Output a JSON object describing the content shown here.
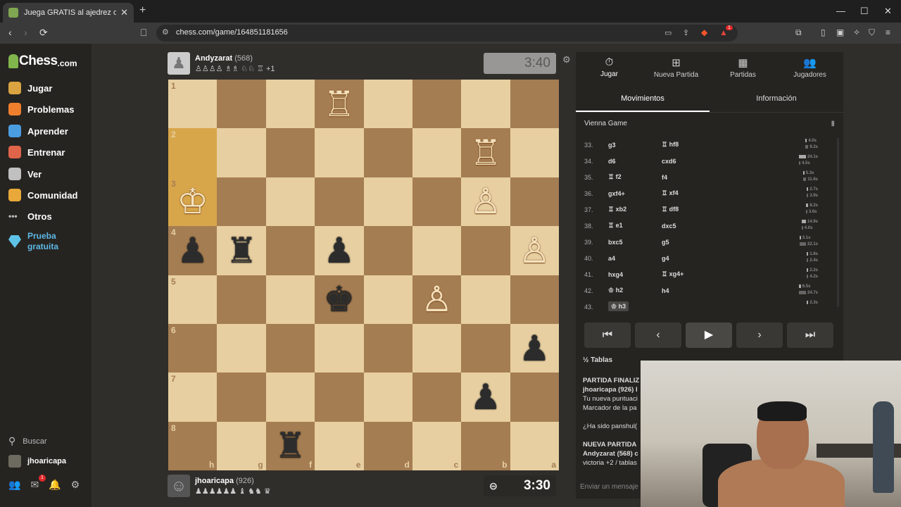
{
  "browser": {
    "tab_title": "Juega GRATIS al ajedrez online -",
    "url": "chess.com/game/164851181656",
    "ext_badge": "1"
  },
  "sidebar": {
    "logo_main": "Chess",
    "logo_com": ".com",
    "items": [
      {
        "label": "Jugar",
        "color": "#d9a441"
      },
      {
        "label": "Problemas",
        "color": "#f07f2d"
      },
      {
        "label": "Aprender",
        "color": "#4a9ee0"
      },
      {
        "label": "Entrenar",
        "color": "#e0644a"
      },
      {
        "label": "Ver",
        "color": "#c0c0c0"
      },
      {
        "label": "Comunidad",
        "color": "#e8a93a"
      },
      {
        "label": "Otros",
        "color": "#bdbdbd"
      }
    ],
    "trial": "Prueba gratuita",
    "search": "Buscar",
    "user": "jhoaricapa",
    "mail_badge": "1"
  },
  "top_player": {
    "name": "Andyzarat",
    "rating": "(568)",
    "captured": "♙♙♙♙ ♗♗ ♘♘ ♖ +1",
    "clock": "3:40"
  },
  "bottom_player": {
    "name": "jhoaricapa",
    "rating": "(926)",
    "captured": "♟♟♟♟♟♟ ♝ ♞♞ ♛",
    "clock": "3:30"
  },
  "board": {
    "ranks": [
      "1",
      "2",
      "3",
      "4",
      "5",
      "6",
      "7",
      "8"
    ],
    "files": [
      "h",
      "g",
      "f",
      "e",
      "d",
      "c",
      "b",
      "a"
    ],
    "pieces": [
      {
        "r": 0,
        "c": 3,
        "p": "♖",
        "side": "w"
      },
      {
        "r": 1,
        "c": 6,
        "p": "♖",
        "side": "w"
      },
      {
        "r": 2,
        "c": 0,
        "p": "♔",
        "side": "w"
      },
      {
        "r": 2,
        "c": 6,
        "p": "♙",
        "side": "w"
      },
      {
        "r": 3,
        "c": 0,
        "p": "♟",
        "side": "b"
      },
      {
        "r": 3,
        "c": 1,
        "p": "♜",
        "side": "b"
      },
      {
        "r": 3,
        "c": 3,
        "p": "♟",
        "side": "b"
      },
      {
        "r": 3,
        "c": 7,
        "p": "♙",
        "side": "w"
      },
      {
        "r": 4,
        "c": 3,
        "p": "♚",
        "side": "b"
      },
      {
        "r": 4,
        "c": 5,
        "p": "♙",
        "side": "w"
      },
      {
        "r": 5,
        "c": 7,
        "p": "♟",
        "side": "b"
      },
      {
        "r": 6,
        "c": 6,
        "p": "♟",
        "side": "b"
      },
      {
        "r": 7,
        "c": 2,
        "p": "♜",
        "side": "b"
      }
    ],
    "highlight": [
      [
        1,
        0
      ],
      [
        2,
        0
      ]
    ]
  },
  "panel": {
    "tabs": [
      {
        "label": "Jugar",
        "icon": "⏱"
      },
      {
        "label": "Nueva Partida",
        "icon": "⊞"
      },
      {
        "label": "Partidas",
        "icon": "▦"
      },
      {
        "label": "Jugadores",
        "icon": "👥"
      }
    ],
    "subtabs": [
      "Movimientos",
      "Información"
    ],
    "opening": "Vienna Game",
    "moves": [
      {
        "n": "33.",
        "w": "g3",
        "b": "♖ hf8",
        "t1": "4.0s",
        "t2": "9.2s",
        "w1": 0.18,
        "w2": 0.4
      },
      {
        "n": "34.",
        "w": "d6",
        "b": "cxd6",
        "t1": "24.1s",
        "t2": "4.5s",
        "w1": 1.0,
        "w2": 0.2
      },
      {
        "n": "35.",
        "w": "♖ f2",
        "b": "f4",
        "t1": "5.3s",
        "t2": "11.6s",
        "w1": 0.22,
        "w2": 0.48
      },
      {
        "n": "36.",
        "w": "gxf4+",
        "b": "♖ xf4",
        "t1": "2.7s",
        "t2": "3.9s",
        "w1": 0.12,
        "w2": 0.17
      },
      {
        "n": "37.",
        "w": "♖ xb2",
        "b": "♖ df8",
        "t1": "8.2s",
        "t2": "3.6s",
        "w1": 0.35,
        "w2": 0.15
      },
      {
        "n": "38.",
        "w": "♖ e1",
        "b": "dxc5",
        "t1": "14.9s",
        "t2": "4.0s",
        "w1": 0.62,
        "w2": 0.18
      },
      {
        "n": "39.",
        "w": "bxc5",
        "b": "g5",
        "t1": "3.1s",
        "t2": "22.1s",
        "w1": 0.14,
        "w2": 0.92
      },
      {
        "n": "40.",
        "w": "a4",
        "b": "g4",
        "t1": "1.6s",
        "t2": "2.4s",
        "w1": 0.08,
        "w2": 0.1
      },
      {
        "n": "41.",
        "w": "hxg4",
        "b": "♖ xg4+",
        "t1": "2.2s",
        "t2": "4.2s",
        "w1": 0.1,
        "w2": 0.18
      },
      {
        "n": "42.",
        "w": "♔ h2",
        "b": "h4",
        "t1": "6.5s",
        "t2": "24.7s",
        "w1": 0.28,
        "w2": 1.0
      },
      {
        "n": "43.",
        "w": "♔ h3",
        "b": "",
        "t1": "2.3s",
        "t2": "",
        "w1": 0.1,
        "w2": 0
      }
    ],
    "tablas": "½ Tablas",
    "chat": [
      {
        "text": "PARTIDA FINALIZ",
        "bold": true
      },
      {
        "text": "jhoaricapa (926) l",
        "bold": true
      },
      {
        "text": "Tu nueva puntuaci",
        "bold": false
      },
      {
        "text": "Marcador de la pa",
        "bold": false
      },
      {
        "text": "",
        "bold": false
      },
      {
        "text": "¿Ha sido panshul(",
        "bold": false
      },
      {
        "text": "",
        "bold": false
      },
      {
        "text": "NUEVA PARTIDA",
        "bold": true
      },
      {
        "text": "Andyzarat (568) c",
        "bold": true
      },
      {
        "text": "victoria +2 / tablas",
        "bold": false
      }
    ],
    "chat_placeholder": "Enviar un mensaje"
  }
}
